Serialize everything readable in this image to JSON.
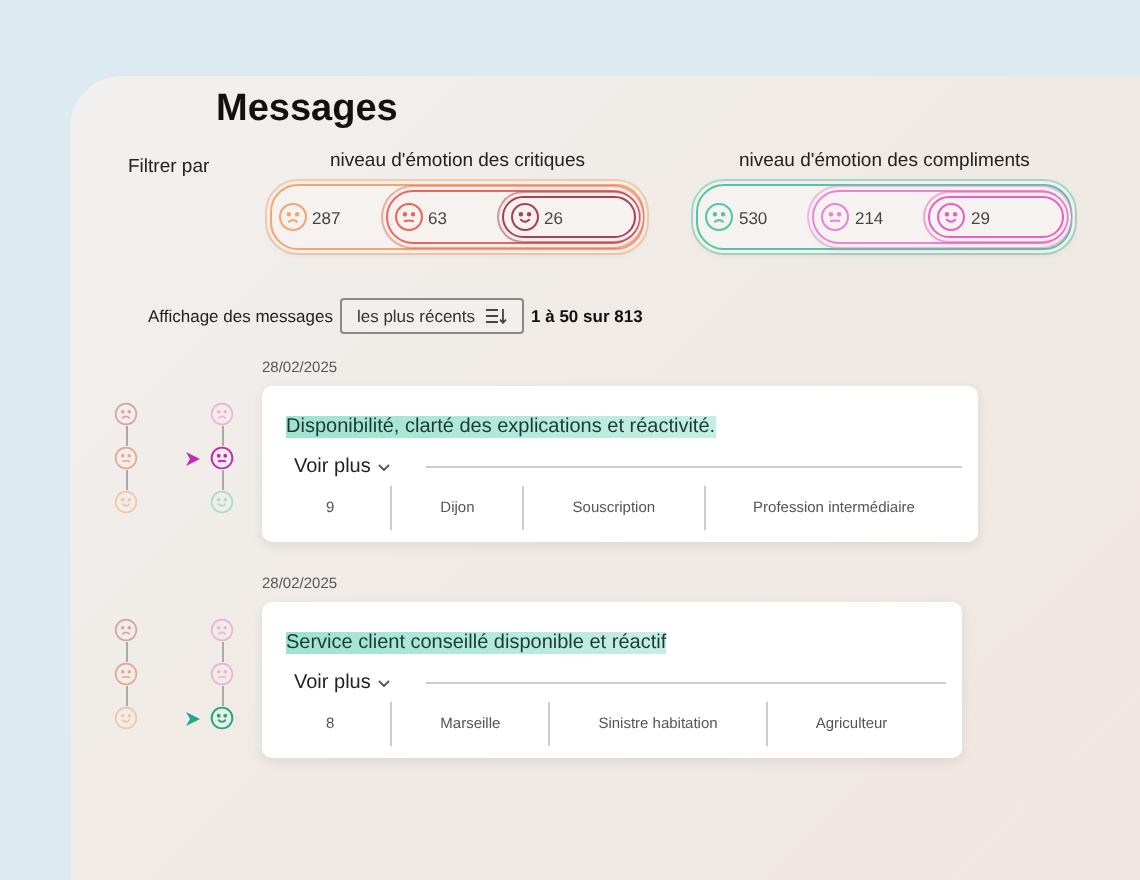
{
  "title": "Messages",
  "filter": {
    "label": "Filtrer par",
    "groups": [
      {
        "label": "niveau d'émotion des critiques",
        "levels": [
          {
            "count": "287",
            "color": "#f3a66f"
          },
          {
            "count": "63",
            "color": "#e8675a"
          },
          {
            "count": "26",
            "color": "#a8405a"
          }
        ]
      },
      {
        "label": "niveau d'émotion des compliments",
        "levels": [
          {
            "count": "530",
            "color": "#4fc6a8"
          },
          {
            "count": "214",
            "color": "#e884d8"
          },
          {
            "count": "29",
            "color": "#e860c4"
          }
        ]
      }
    ]
  },
  "sort": {
    "label": "Affichage des messages",
    "button": "les plus récents",
    "range": "1 à 50 sur 813"
  },
  "messages": [
    {
      "date": "28/02/2025",
      "text": "Disponibilité, clarté des explications et réactivité.",
      "more": "Voir plus",
      "critique_faces": [
        {
          "color": "#d9a0a8",
          "selected": false
        },
        {
          "color": "#eea290",
          "selected": false
        },
        {
          "color": "#f6c4a4",
          "selected": false
        }
      ],
      "compliment_faces": [
        {
          "color": "#f0b0d8",
          "selected": false
        },
        {
          "color": "#c02cb4",
          "selected": true
        },
        {
          "color": "#a8dccb",
          "selected": false
        }
      ],
      "cells": [
        "9",
        "Dijon",
        "Souscription",
        "Profession intermédiaire"
      ]
    },
    {
      "date": "28/02/2025",
      "text": "Service client conseillé disponible et réactif",
      "more": "Voir plus",
      "critique_faces": [
        {
          "color": "#d9a0a8",
          "selected": false
        },
        {
          "color": "#eea290",
          "selected": false
        },
        {
          "color": "#f6c4a4",
          "selected": false
        }
      ],
      "compliment_faces": [
        {
          "color": "#f0b0d8",
          "selected": false
        },
        {
          "color": "#f0b0d8",
          "selected": false
        },
        {
          "color": "#1fa882",
          "selected": true
        }
      ],
      "cells": [
        "8",
        "Marseille",
        "Sinistre habitation",
        "Agriculteur"
      ]
    }
  ]
}
